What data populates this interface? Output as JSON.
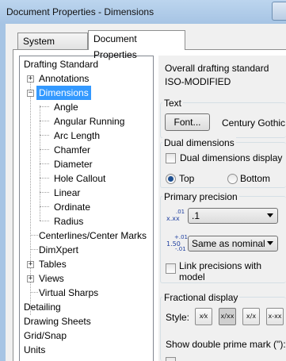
{
  "window": {
    "title": "Document Properties - Dimensions"
  },
  "tabs": [
    {
      "label": "System Options",
      "active": false
    },
    {
      "label": "Document Properties",
      "active": true
    }
  ],
  "tree": {
    "items": [
      {
        "label": "Drafting Standard"
      },
      {
        "label": "Annotations",
        "expander": "+"
      },
      {
        "label": "Dimensions",
        "expander": "−",
        "selected": true
      },
      {
        "label": "Angle"
      },
      {
        "label": "Angular Running"
      },
      {
        "label": "Arc Length"
      },
      {
        "label": "Chamfer"
      },
      {
        "label": "Diameter"
      },
      {
        "label": "Hole Callout"
      },
      {
        "label": "Linear"
      },
      {
        "label": "Ordinate"
      },
      {
        "label": "Radius"
      },
      {
        "label": "Centerlines/Center Marks"
      },
      {
        "label": "DimXpert"
      },
      {
        "label": "Tables",
        "expander": "+"
      },
      {
        "label": "Views",
        "expander": "+"
      },
      {
        "label": "Virtual Sharps"
      },
      {
        "label": "Detailing"
      },
      {
        "label": "Drawing Sheets"
      },
      {
        "label": "Grid/Snap"
      },
      {
        "label": "Units"
      }
    ]
  },
  "overall": {
    "label": "Overall drafting standard",
    "value": "ISO-MODIFIED"
  },
  "text_group": {
    "title": "Text",
    "font_button": "Font...",
    "font_name": "Century Gothic"
  },
  "dual": {
    "title": "Dual dimensions",
    "display_label": "Dual dimensions display",
    "top_label": "Top",
    "bottom_label": "Bottom",
    "selected": "Top"
  },
  "precision": {
    "title": "Primary precision",
    "unit_icon_top": ".01",
    "unit_icon_main": "x.xx",
    "tol_icon_top": "+.01",
    "tol_icon_main": "1.50",
    "tol_icon_bottom": "-.01",
    "value_select": ".1",
    "tolerance_select": "Same as nominal",
    "link_label": "Link precisions with model"
  },
  "fractional": {
    "title": "Fractional display",
    "style_label": "Style:",
    "styles": [
      "x⁄x",
      "x/xx",
      "x/x",
      "x-xx"
    ],
    "selected_index": 1,
    "double_prime_label": "Show double prime mark (\"):"
  },
  "colors": {
    "selection": "#3399ff",
    "title_bar": "#a6c4e4",
    "panel": "#f0f0f0"
  }
}
